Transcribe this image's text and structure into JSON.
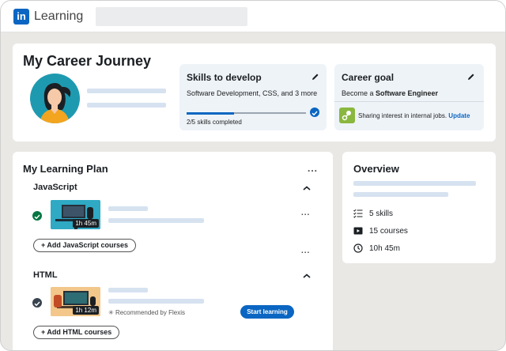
{
  "header": {
    "logo_mark": "in",
    "app_name": "Learning"
  },
  "journey": {
    "title": "My Career Journey",
    "skills_card": {
      "title": "Skills to develop",
      "skills_text": "Software Development, CSS, and 3 more",
      "progress_fraction": 0.4,
      "progress_label": "2/5 skills completed"
    },
    "goal_card": {
      "title": "Career goal",
      "goal_prefix": "Become a ",
      "goal_role": "Software Engineer",
      "interest_text": "Sharing interest in internal jobs.",
      "update_link": "Update"
    }
  },
  "plan": {
    "title": "My Learning Plan",
    "more_label": "...",
    "sections": [
      {
        "title": "JavaScript",
        "course_duration": "1h 45m",
        "completed": true,
        "add_button": "+ Add JavaScript courses"
      },
      {
        "title": "HTML",
        "course_duration": "1h 12m",
        "completed": true,
        "recommended": "Recommended by Flexis",
        "start_button": "Start learning",
        "add_button": "+ Add HTML courses"
      }
    ]
  },
  "overview": {
    "title": "Overview",
    "stats": [
      {
        "icon": "checklist-icon",
        "label": "5 skills"
      },
      {
        "icon": "video-icon",
        "label": "15 courses"
      },
      {
        "icon": "clock-icon",
        "label": "10h 45m"
      }
    ]
  },
  "colors": {
    "brand": "#0a66c2",
    "success": "#057642",
    "background": "#e9e8e5"
  }
}
